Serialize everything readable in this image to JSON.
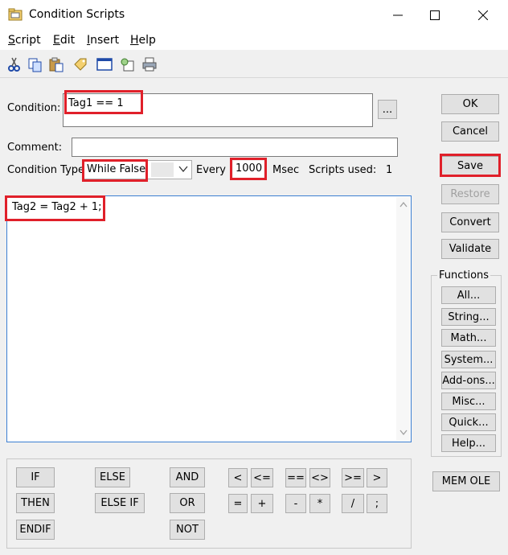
{
  "window": {
    "title": "Condition Scripts",
    "minimize": "—",
    "maximize": "☐",
    "close": "✕"
  },
  "menu": {
    "items": [
      {
        "u": "S",
        "rest": "cript"
      },
      {
        "u": "E",
        "rest": "dit"
      },
      {
        "u": "I",
        "rest": "nsert"
      },
      {
        "u": "H",
        "rest": "elp"
      }
    ]
  },
  "toolbar": {
    "icons": [
      "cut-icon",
      "copy-icon",
      "paste-icon",
      "tag-icon",
      "window-icon",
      "find-icon",
      "print-icon"
    ]
  },
  "form": {
    "condition_label": "Condition:",
    "condition_value": "Tag1 == 1",
    "browse_label": "...",
    "comment_label": "Comment:",
    "comment_value": "",
    "condition_type_label": "Condition Type:",
    "condition_type_value": "While False",
    "every_label": "Every",
    "every_value": "1000",
    "msec_label": "Msec",
    "scripts_used_label": "Scripts used:",
    "scripts_used_value": "1"
  },
  "editor": {
    "content": "Tag2 = Tag2 + 1;"
  },
  "side_buttons": {
    "ok": "OK",
    "cancel": "Cancel",
    "save": "Save",
    "restore": "Restore",
    "convert": "Convert",
    "validate": "Validate"
  },
  "functions": {
    "title": "Functions",
    "buttons": [
      "All...",
      "String...",
      "Math...",
      "System...",
      "Add-ons...",
      "Misc...",
      "Quick...",
      "Help..."
    ]
  },
  "mem_ole": "MEM OLE",
  "keywords": {
    "if": "IF",
    "then": "THEN",
    "endif": "ENDIF",
    "else": "ELSE",
    "else_if": "ELSE IF",
    "and": "AND",
    "or": "OR",
    "not": "NOT"
  },
  "operators": {
    "row1": [
      "<",
      "<=",
      "==",
      "<>",
      ">=",
      ">"
    ],
    "row2": [
      "=",
      "+",
      "-",
      "*",
      "/",
      ";"
    ]
  },
  "highlight_color": "#e0202a"
}
